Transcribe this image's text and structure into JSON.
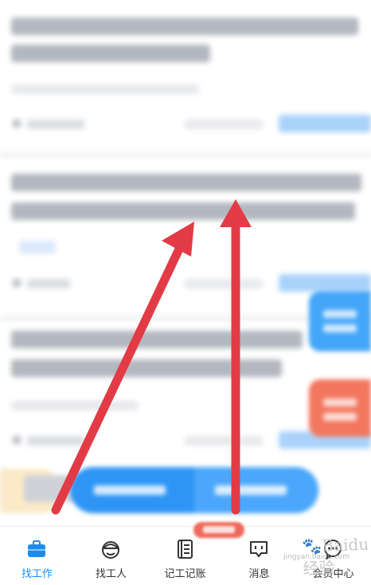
{
  "colors": {
    "accent": "#1c8cf0",
    "annotation_arrow": "#e23b46",
    "float_blue": "#44a6f8",
    "float_red": "#f3765e",
    "cta_blue": "#2e95f5"
  },
  "tabbar": {
    "items": [
      {
        "label": "找工作",
        "icon": "briefcase-icon",
        "active": true
      },
      {
        "label": "找工人",
        "icon": "worker-helmet-icon",
        "active": false
      },
      {
        "label": "记工记账",
        "icon": "ledger-icon",
        "active": false
      },
      {
        "label": "消息",
        "icon": "message-icon",
        "active": false
      },
      {
        "label": "会员中心",
        "icon": "member-chat-icon",
        "active": false
      }
    ]
  },
  "watermark": {
    "text": "Baidu经验",
    "icon": "baidu-paw-icon"
  }
}
